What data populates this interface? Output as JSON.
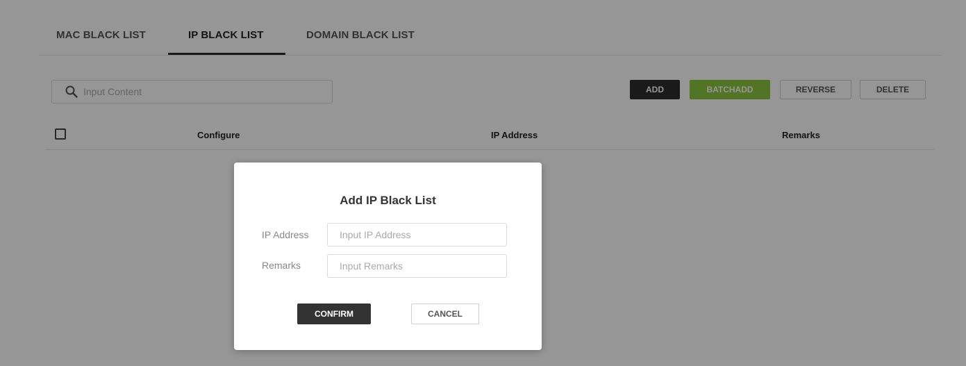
{
  "tabs": [
    {
      "label": "MAC BLACK LIST",
      "active": false
    },
    {
      "label": "IP BLACK LIST",
      "active": true
    },
    {
      "label": "DOMAIN BLACK LIST",
      "active": false
    }
  ],
  "search": {
    "placeholder": "Input Content",
    "icon": "search-icon"
  },
  "toolbar": {
    "add_label": "ADD",
    "batchadd_label": "BATCHADD",
    "reverse_label": "REVERSE",
    "delete_label": "DELETE"
  },
  "table": {
    "columns": [
      "Configure",
      "IP Address",
      "Remarks"
    ],
    "rows": []
  },
  "dialog": {
    "title": "Add IP Black List",
    "ip_label": "IP Address",
    "ip_placeholder": "Input IP Address",
    "ip_value": "",
    "remarks_label": "Remarks",
    "remarks_placeholder": "Input Remarks",
    "remarks_value": "",
    "confirm_label": "CONFIRM",
    "cancel_label": "CANCEL"
  },
  "colors": {
    "accent_green": "#8cc63f",
    "primary_dark": "#2d2d2d",
    "overlay": "rgba(0,0,0,0.41)"
  }
}
